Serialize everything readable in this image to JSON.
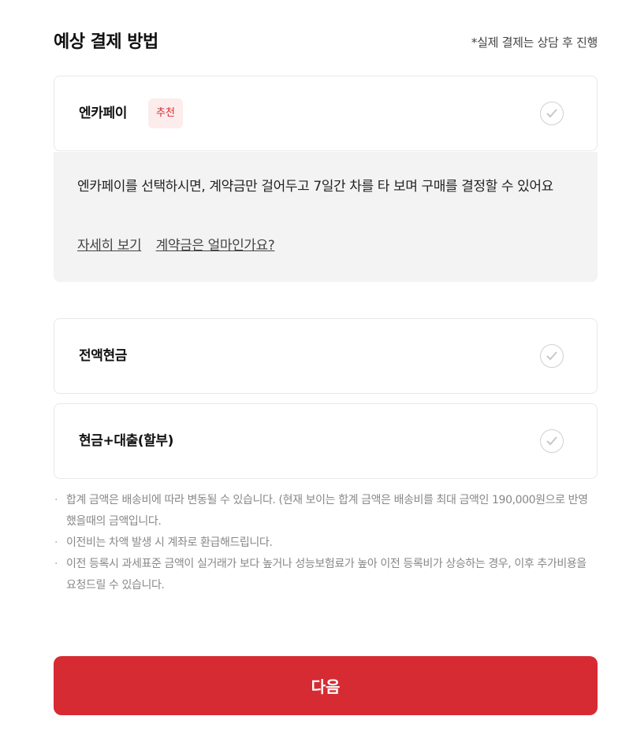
{
  "header": {
    "title": "예상 결제 방법",
    "note": "*실제 결제는 상담 후 진행"
  },
  "options": [
    {
      "label": "엔카페이",
      "badge": "추천"
    },
    {
      "label": "전액현금"
    },
    {
      "label": "현금+대출(할부)"
    }
  ],
  "info": {
    "description": "엔카페이를 선택하시면, 계약금만 걸어두고 7일간 차를 타 보며 구매를 결정할 수 있어요",
    "links": [
      "자세히 보기",
      "계약금은 얼마인가요?"
    ]
  },
  "notes": [
    "합계 금액은 배송비에 따라 변동될 수 있습니다. (현재 보이는 합계 금액은 배송비를 최대 금액인 190,000원으로 반영했을때의 금액입니다.",
    "이전비는 차액 발생 시 계좌로 환급해드립니다.",
    "이전 등록시 과세표준 금액이 실거래가 보다 높거나 성능보험료가 높아 이전 등록비가 상승하는 경우, 이후 추가비용을 요청드릴 수 있습니다."
  ],
  "next_button": "다음",
  "colors": {
    "accent": "#d62b33",
    "badge_bg": "#fdecec",
    "info_bg": "#f3f3f3"
  },
  "icons": {
    "check": "check-circle-icon"
  }
}
